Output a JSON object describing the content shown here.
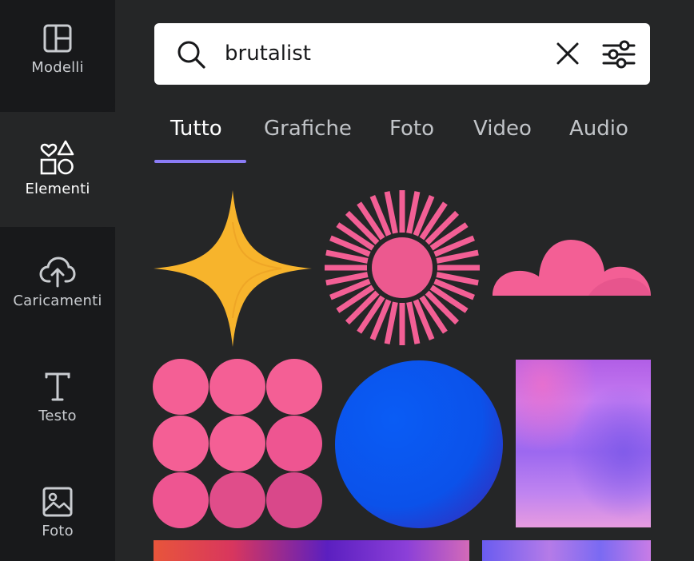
{
  "sidebar": {
    "items": [
      {
        "label": "Modelli",
        "icon": "templates-icon"
      },
      {
        "label": "Elementi",
        "icon": "elements-icon"
      },
      {
        "label": "Caricamenti",
        "icon": "upload-cloud-icon"
      },
      {
        "label": "Testo",
        "icon": "text-icon"
      },
      {
        "label": "Foto",
        "icon": "photo-icon"
      }
    ],
    "active": "Elementi"
  },
  "search": {
    "value": "brutalist",
    "placeholder": "",
    "icons": [
      "search-icon",
      "clear-icon",
      "filter-sliders-icon"
    ]
  },
  "tabs": {
    "items": [
      "Tutto",
      "Grafiche",
      "Foto",
      "Video",
      "Audio"
    ],
    "active": "Tutto"
  },
  "results": [
    {
      "name": "yellow-sparkle-star",
      "color": "#f7b42c"
    },
    {
      "name": "pink-sunburst",
      "color": "#f35f95"
    },
    {
      "name": "pink-cloud",
      "color": "#f35f95"
    },
    {
      "name": "pink-circles-grid",
      "color": "#f45f95"
    },
    {
      "name": "blue-circle",
      "color": "#0a5cf5"
    },
    {
      "name": "purple-gradient-square",
      "color": "#b96ff0"
    },
    {
      "name": "orange-purple-gradient-strip",
      "color": "#e8553b"
    },
    {
      "name": "blue-purple-gradient-strip",
      "color": "#6a5cf0"
    }
  ],
  "colors": {
    "background": "#252627",
    "rail": "#18191b",
    "accent": "#8b7cf6"
  }
}
